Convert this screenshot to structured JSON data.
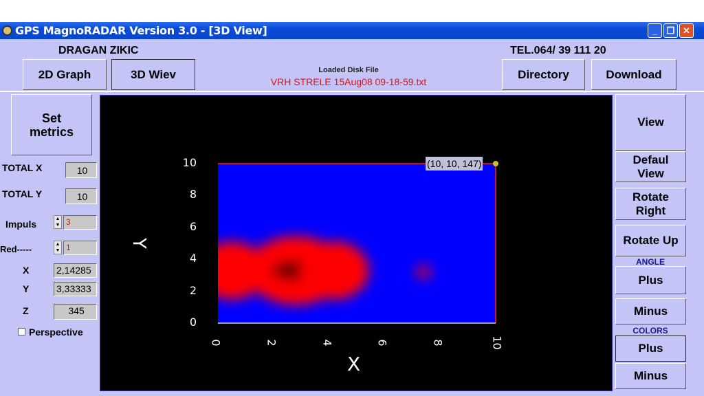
{
  "window": {
    "title": "GPS MagnoRADAR Version 3.0 - [3D View]",
    "controls": [
      "_",
      "❐",
      "✕"
    ]
  },
  "header": {
    "owner": "DRAGAN  ZIKIC",
    "phone": "TEL.064/ 39 111 20",
    "loaded_label": "Loaded Disk File",
    "loaded_file": "VRH STRELE 15Aug08 09-18-59.txt"
  },
  "toolbar": {
    "graph2d": "2D Graph",
    "view3d": "3D Wiev",
    "directory": "Directory",
    "download": "Download"
  },
  "left": {
    "set_metrics": "Set metrics",
    "total_x_label": "TOTAL X",
    "total_x": "10",
    "total_y_label": "TOTAL Y",
    "total_y": "10",
    "impuls_label": "Impuls",
    "impuls": "3",
    "red_label": "Red-----",
    "red": "1",
    "x_label": "X",
    "x": "2,14285",
    "y_label": "Y",
    "y": "3,33333",
    "z_label": "Z",
    "z": "345",
    "perspective": "Perspective",
    "perspective_checked": false
  },
  "right": {
    "view": "View",
    "default_view": "Defaul View",
    "rotate_right": "Rotate Right",
    "rotate_up": "Rotate Up",
    "angle": "ANGLE",
    "angle_plus": "Plus",
    "angle_minus": "Minus",
    "colors": "COLORS",
    "colors_plus": "Plus",
    "colors_minus": "Minus"
  },
  "chart_data": {
    "type": "heatmap",
    "xlabel": "X",
    "ylabel": "Y",
    "xlim": [
      0,
      10
    ],
    "ylim": [
      0,
      10
    ],
    "x_ticks": [
      "0",
      "2",
      "4",
      "6",
      "8",
      "10"
    ],
    "y_ticks": [
      "0",
      "2",
      "4",
      "6",
      "8",
      "10"
    ],
    "tooltip": "(10, 10, 147)",
    "hotspots": [
      {
        "x": 0.5,
        "y": 3.3,
        "intensity": 0.6
      },
      {
        "x": 2.8,
        "y": 3.3,
        "intensity": 1.0
      },
      {
        "x": 4.2,
        "y": 3.3,
        "intensity": 0.6
      },
      {
        "x": 7.4,
        "y": 3.2,
        "intensity": 0.3
      }
    ],
    "colors": {
      "low": "#0000ff",
      "mid": "#ff0000",
      "high": "#600000"
    }
  }
}
